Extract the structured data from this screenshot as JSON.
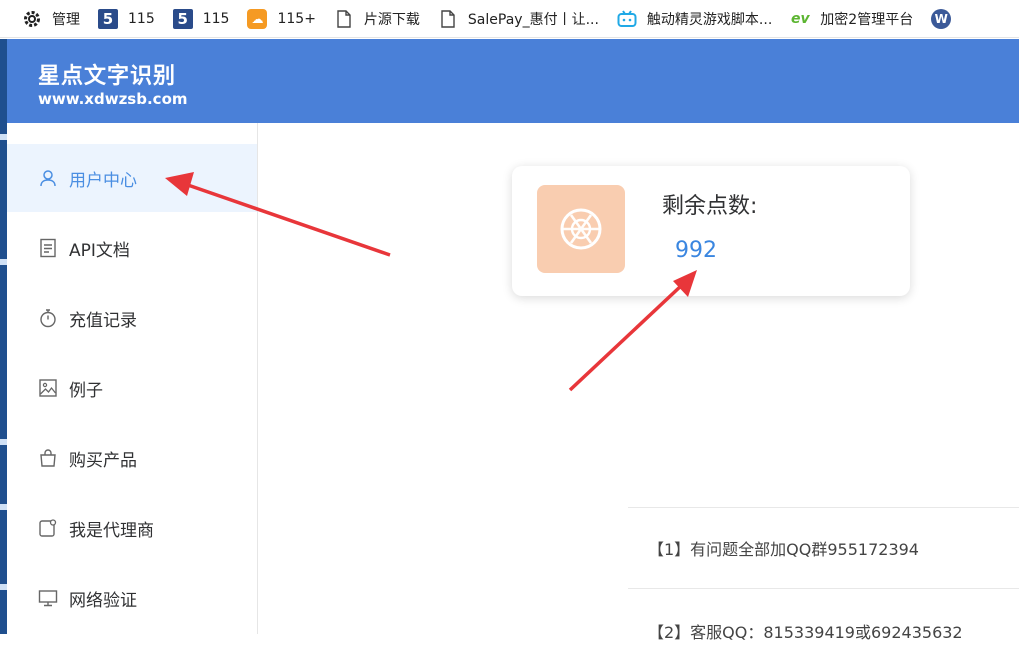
{
  "bookmarks": [
    {
      "icon": "gear-icon",
      "label": "管理"
    },
    {
      "icon": "five-logo-icon",
      "label": "115"
    },
    {
      "icon": "five-logo-icon",
      "label": "115"
    },
    {
      "icon": "cloud-icon",
      "label": "115+"
    },
    {
      "icon": "document-icon",
      "label": "片源下载"
    },
    {
      "icon": "document-icon",
      "label": "SalePay_惠付丨让..."
    },
    {
      "icon": "bilibili-icon",
      "label": "触动精灵游戏脚本..."
    },
    {
      "icon": "ev-logo-icon",
      "label": "加密2管理平台"
    },
    {
      "icon": "wordpress-icon",
      "label": ""
    }
  ],
  "header": {
    "title": "星点文字识别",
    "url": "www.xdwzsb.com"
  },
  "sidebar": {
    "items": [
      {
        "label": "用户中心",
        "icon": "user-icon",
        "active": true
      },
      {
        "label": "API文档",
        "icon": "document-icon",
        "active": false
      },
      {
        "label": "充值记录",
        "icon": "stopwatch-icon",
        "active": false
      },
      {
        "label": "例子",
        "icon": "image-icon",
        "active": false
      },
      {
        "label": "购买产品",
        "icon": "shopping-bag-icon",
        "active": false
      },
      {
        "label": "我是代理商",
        "icon": "agent-icon",
        "active": false
      },
      {
        "label": "网络验证",
        "icon": "monitor-icon",
        "active": false
      }
    ]
  },
  "card": {
    "label": "剩余点数:",
    "value": "992",
    "icon_bg": "#f9cdb0"
  },
  "notices": [
    "【1】有问题全部加QQ群955172394",
    "【2】客服QQ：815339419或692435632"
  ],
  "colors": {
    "header_bg": "#4a80d8",
    "accent": "#3a86e0",
    "active_bg": "#ecf4fe",
    "arrow": "#e8363a"
  }
}
